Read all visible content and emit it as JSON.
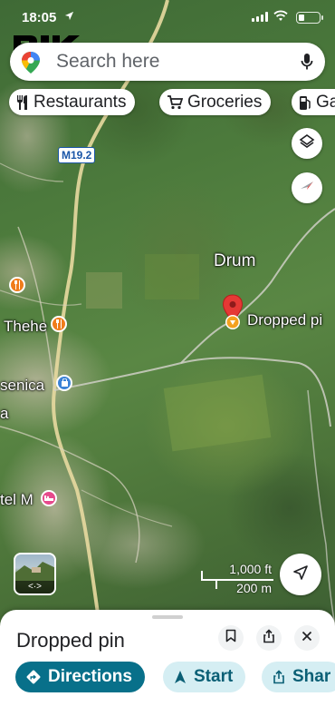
{
  "status_bar": {
    "time": "18:05",
    "signal_bars": 4,
    "battery_level": 0.25
  },
  "watermark": "PIK",
  "search": {
    "placeholder": "Search here"
  },
  "chips": [
    {
      "label": "Restaurants",
      "icon": "fork-knife-icon"
    },
    {
      "label": "Groceries",
      "icon": "cart-icon"
    },
    {
      "label": "Ga",
      "icon": "gas-pump-icon"
    }
  ],
  "map": {
    "road_shield": "M19.2",
    "labels": {
      "drum": "Drum",
      "dropped_pin": "Dropped pi",
      "thehe": "Thehe",
      "senica": "senica",
      "a": "a",
      "tel_m": "tel M"
    },
    "scale": {
      "imperial": "1,000 ft",
      "metric": "200 m"
    },
    "colors": {
      "pin_red": "#e53935",
      "poi_orange": "#f07c1b",
      "poi_blue": "#3b82d6",
      "poi_pink": "#e64a8c"
    }
  },
  "sheet": {
    "title": "Dropped pin",
    "actions": [
      {
        "label": "Directions",
        "icon": "directions-icon",
        "style": "primary"
      },
      {
        "label": "Start",
        "icon": "navigation-arrow-icon",
        "style": "secondary"
      },
      {
        "label": "Shar",
        "icon": "share-icon",
        "style": "secondary"
      }
    ]
  },
  "accent_color": "#08708a"
}
